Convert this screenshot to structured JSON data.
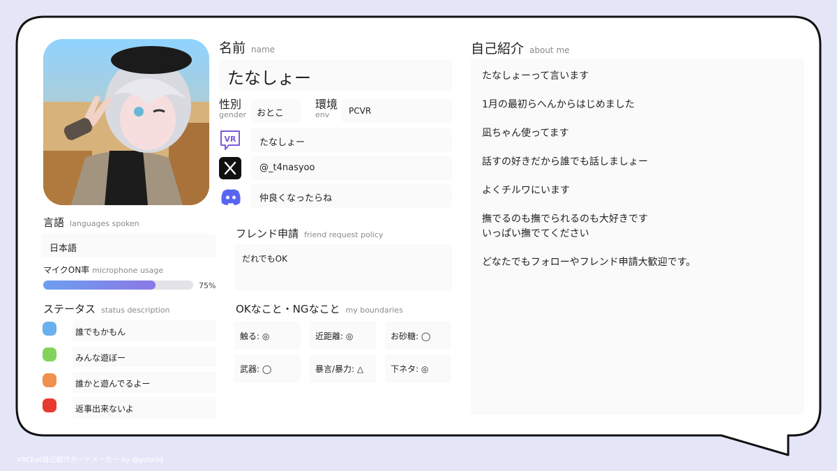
{
  "colors": {
    "background": "#e4e6f8",
    "card": "#ffffff",
    "bar": "#7b8de8"
  },
  "avatar": {
    "icon": "avatar-photo"
  },
  "name": {
    "label": "名前",
    "sub": "name",
    "value": "たなしょー"
  },
  "gender": {
    "label": "性別",
    "sub": "gender",
    "value": "おとこ"
  },
  "env": {
    "label": "環境",
    "sub": "env",
    "value": "PCVR"
  },
  "socials": [
    {
      "icon": "vrchat-icon",
      "value": "たなしょー"
    },
    {
      "icon": "x-icon",
      "value": "@_t4nasyoo"
    },
    {
      "icon": "discord-icon",
      "value": "仲良くなったらね"
    }
  ],
  "languages": {
    "label": "言語",
    "sub": "languages spoken",
    "value": "日本語"
  },
  "mic": {
    "label": "マイクON率",
    "sub": "microphone usage",
    "percent": 75,
    "percent_text": "75%"
  },
  "status": {
    "label": "ステータス",
    "sub": "status description",
    "items": [
      {
        "color": "#6ab0ec",
        "text": "誰でもかもん"
      },
      {
        "color": "#82d35c",
        "text": "みんな遊ぼー"
      },
      {
        "color": "#f0904e",
        "text": "誰かと遊んでるよー"
      },
      {
        "color": "#e63b2e",
        "text": "返事出来ないよ"
      }
    ]
  },
  "friend_request": {
    "label": "フレンド申請",
    "sub": "friend request policy",
    "value": "だれでもOK"
  },
  "boundaries": {
    "label": "OKなこと・NGなこと",
    "sub": "my boundaries",
    "items": [
      "触る: ◎",
      "近距離: ◎",
      "お砂糖: ◯",
      "武器: ◯",
      "暴言/暴力: △",
      "下ネタ: ◎"
    ]
  },
  "about": {
    "label": "自己紹介",
    "sub": "about me",
    "lines": [
      "たなしょーって言います",
      "1月の最初らへんからはじめました",
      "凪ちゃん使ってます",
      "話すの好きだから誰でも話しましょー",
      "よくチルワにいます",
      "撫でるのも撫でられるのも大好きです",
      "いっぱい撫でてください",
      "どなたでもフォローやフレンド申請大歓迎です。"
    ]
  },
  "footer": "VRChat自己紹介カードメーカー by @yota3d"
}
